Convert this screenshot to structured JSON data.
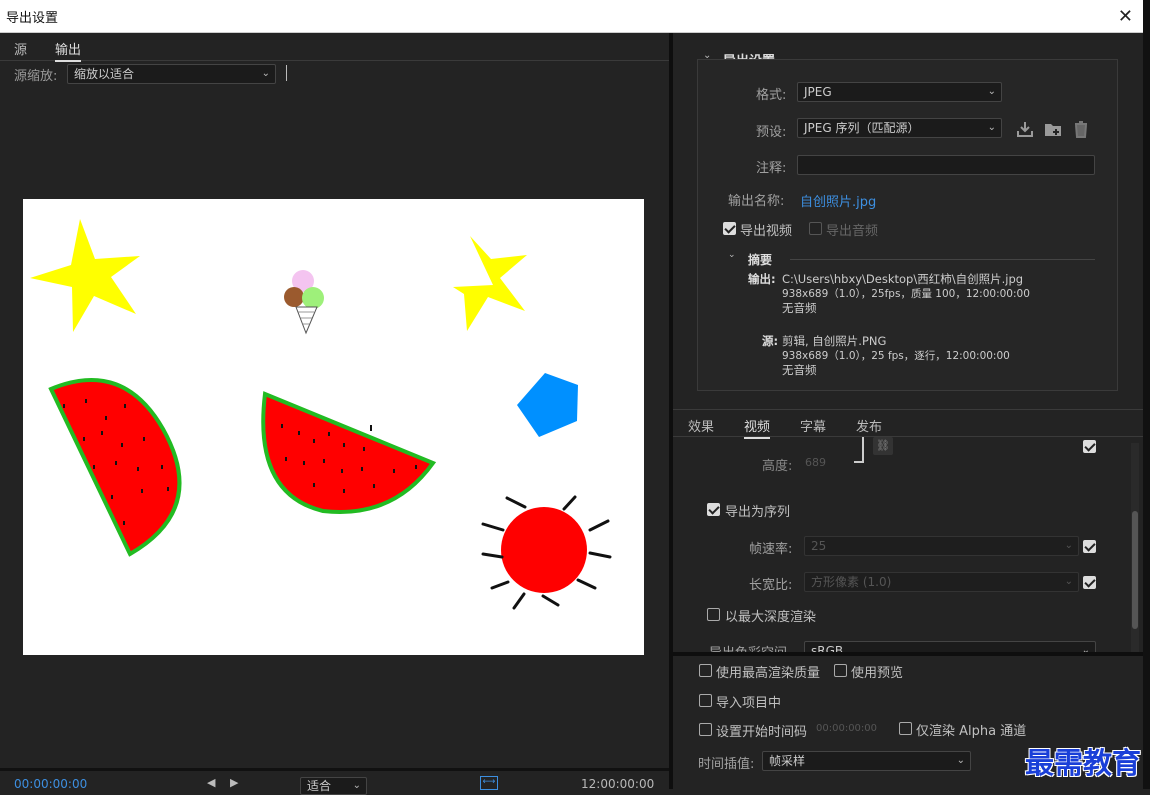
{
  "window": {
    "title": "导出设置"
  },
  "left": {
    "tabs": [
      "源",
      "输出"
    ],
    "source_scale_label": "源缩放:",
    "source_scale_value": "缩放以适合",
    "timecode_start": "00:00:00:00",
    "fit_value": "适合",
    "timecode_end": "12:00:00:00"
  },
  "export_settings": {
    "header": "导出设置",
    "format_label": "格式:",
    "format_value": "JPEG",
    "preset_label": "预设:",
    "preset_value": "JPEG 序列（匹配源）",
    "comment_label": "注释:",
    "comment_value": "",
    "output_name_label": "输出名称:",
    "output_name_value": "自创照片.jpg",
    "export_video_label": "导出视频",
    "export_audio_label": "导出音频",
    "summary_header": "摘要",
    "summary": {
      "output_label": "输出:",
      "output_path": "C:\\Users\\hbxy\\Desktop\\西红柿\\自创照片.jpg",
      "output_line2": "938x689（1.0），25fps，质量 100，12:00:00:00",
      "output_line3": "无音频",
      "source_label": "源:",
      "source_line1": "剪辑, 自创照片.PNG",
      "source_line2": "938x689（1.0），25 fps，逐行，12:00:00:00",
      "source_line3": "无音频"
    }
  },
  "right_tabs": [
    "效果",
    "视频",
    "字幕",
    "发布"
  ],
  "video": {
    "height_label": "高度:",
    "height_value": "689",
    "export_sequence_label": "导出为序列",
    "frame_rate_label": "帧速率:",
    "frame_rate_value": "25",
    "aspect_label": "长宽比:",
    "aspect_value": "方形像素 (1.0)",
    "max_depth_label": "以最大深度渲染",
    "color_space_label": "导出色彩空间",
    "color_space_value": "sRGB"
  },
  "bottom_options": {
    "max_render_quality": "使用最高渲染质量",
    "use_previews": "使用预览",
    "import_into_project": "导入项目中",
    "set_start_timecode": "设置开始时间码",
    "start_timecode_value": "00:00:00:00",
    "alpha_only": "仅渲染 Alpha 通道",
    "interpolation_label": "时间插值:",
    "interpolation_value": "帧采样"
  },
  "watermark": "最需教育",
  "colors": {
    "link": "#3d8fe0",
    "sun": "#ff0000",
    "star": "#ffff00",
    "pentagon": "#0090ff",
    "rind": "#22bb22"
  }
}
